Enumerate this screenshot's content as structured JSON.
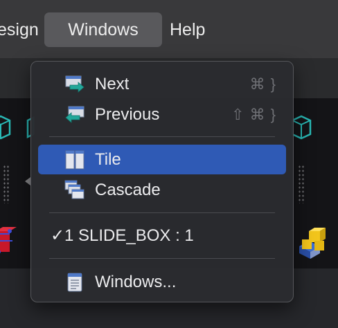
{
  "menubar": {
    "items": [
      {
        "label": "esign"
      },
      {
        "label": "Windows"
      },
      {
        "label": "Help"
      }
    ]
  },
  "windows_menu": {
    "items": [
      {
        "label": "Next",
        "shortcut": "⌘ }",
        "icon": "next-window-icon"
      },
      {
        "label": "Previous",
        "shortcut": "⇧ ⌘ }",
        "icon": "previous-window-icon"
      },
      {
        "label": "Tile",
        "icon": "tile-windows-icon",
        "highlighted": true
      },
      {
        "label": "Cascade",
        "icon": "cascade-windows-icon"
      },
      {
        "label": "1 SLIDE_BOX : 1",
        "check": "✓",
        "checked": true
      },
      {
        "label": "Windows...",
        "icon": "windows-list-icon"
      }
    ]
  },
  "colors": {
    "highlight": "#2f5ab5",
    "menubar": "#39393b",
    "menu_bg": "#2a2b2f"
  }
}
